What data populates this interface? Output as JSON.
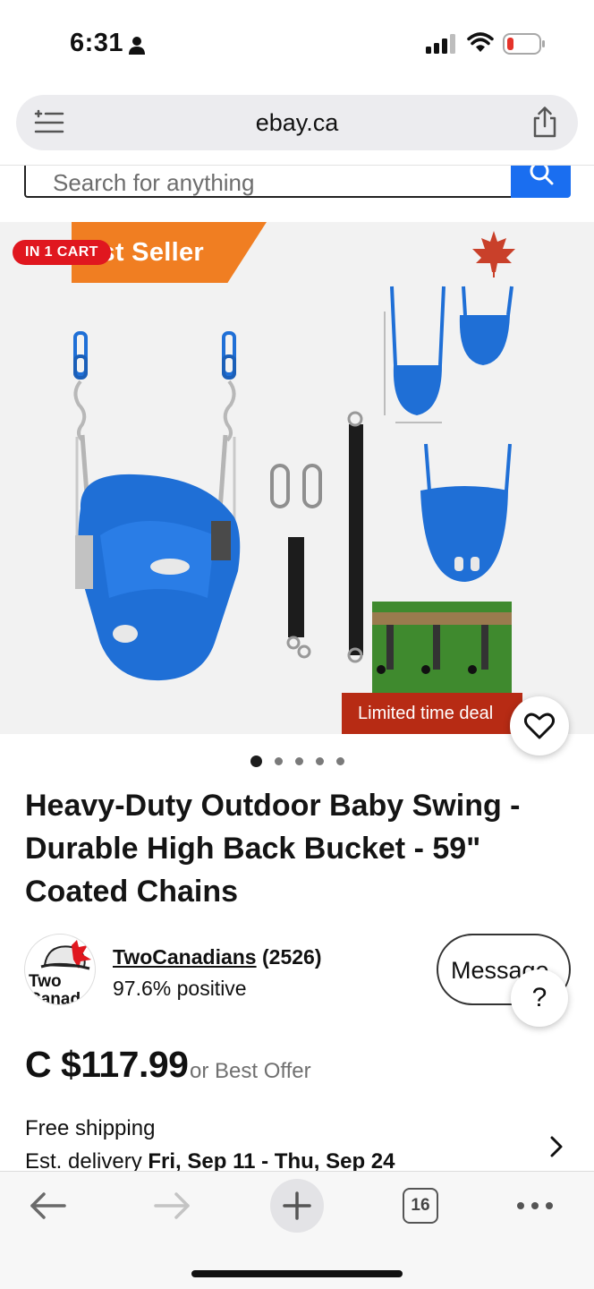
{
  "status_bar": {
    "time": "6:31"
  },
  "browser": {
    "url": "ebay.ca",
    "tab_count": "16"
  },
  "search": {
    "placeholder": "Search for anything"
  },
  "image": {
    "badge": "IN 1 CART",
    "banner": "est Seller",
    "deal": "Limited time deal",
    "carousel_count": 5,
    "carousel_active": 0
  },
  "product": {
    "title": "Heavy-Duty Outdoor Baby Swing - Durable High Back Bucket - 59\" Coated Chains",
    "price": "C $117.99",
    "offer": "or Best Offer"
  },
  "seller": {
    "name": "TwoCanadians",
    "count": "(2526)",
    "feedback": "97.6% positive",
    "avatar_text": "Two Canad",
    "message_label": "Message"
  },
  "shipping": {
    "title": "Free shipping",
    "delivery_prefix": "Est. delivery",
    "delivery_dates": "Fri, Sep 11 - Thu, Sep 24"
  },
  "help": {
    "label": "?"
  },
  "colors": {
    "ebay_blue": "#1a6ef0",
    "badge_red": "#e0171f",
    "banner_orange": "#f07e22",
    "deal_red": "#b72b14",
    "swing_blue": "#1f6fd6"
  }
}
